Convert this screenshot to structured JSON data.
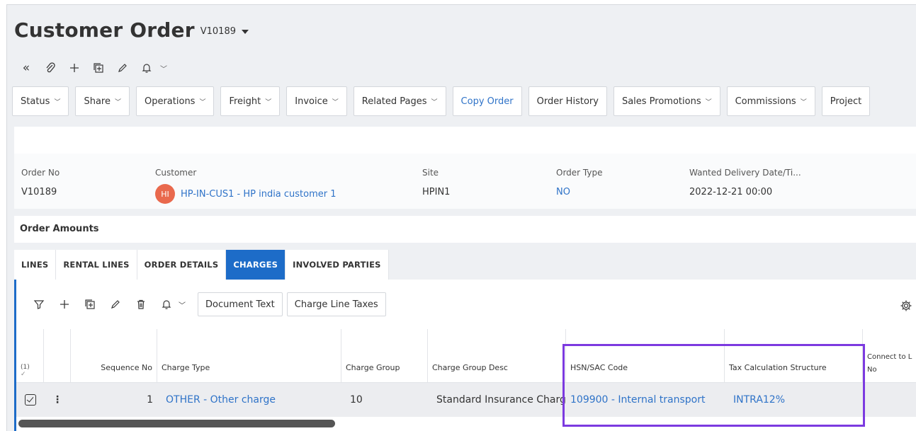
{
  "page": {
    "title": "Customer Order",
    "order_ref": "V10189"
  },
  "commands": [
    {
      "label": "Status",
      "chevron": true,
      "link": false
    },
    {
      "label": "Share",
      "chevron": true,
      "link": false
    },
    {
      "label": "Operations",
      "chevron": true,
      "link": false
    },
    {
      "label": "Freight",
      "chevron": true,
      "link": false
    },
    {
      "label": "Invoice",
      "chevron": true,
      "link": false
    },
    {
      "label": "Related Pages",
      "chevron": true,
      "link": false
    },
    {
      "label": "Copy Order",
      "chevron": false,
      "link": true
    },
    {
      "label": "Order History",
      "chevron": false,
      "link": false
    },
    {
      "label": "Sales Promotions",
      "chevron": true,
      "link": false
    },
    {
      "label": "Commissions",
      "chevron": true,
      "link": false
    },
    {
      "label": "Project",
      "chevron": false,
      "link": false
    }
  ],
  "header": {
    "order_no_label": "Order No",
    "order_no": "V10189",
    "customer_label": "Customer",
    "customer_initials": "HI",
    "customer": "HP-IN-CUS1 - HP india customer 1",
    "site_label": "Site",
    "site": "HPIN1",
    "order_type_label": "Order Type",
    "order_type": "NO",
    "wanted_label": "Wanted Delivery Date/Ti...",
    "wanted": "2022-12-21 00:00"
  },
  "amounts": {
    "title": "Order Amounts"
  },
  "tabs": [
    "LINES",
    "RENTAL LINES",
    "ORDER DETAILS",
    "CHARGES",
    "INVOLVED PARTIES"
  ],
  "active_tab": "CHARGES",
  "grid_toolbar": {
    "document_text": "Document Text",
    "charge_line_taxes": "Charge Line Taxes"
  },
  "table": {
    "selection_count": "(1)",
    "columns": {
      "sequence_no": "Sequence No",
      "charge_type": "Charge Type",
      "charge_group": "Charge Group",
      "charge_group_desc": "Charge Group Desc",
      "hsn_sac": "HSN/SAC Code",
      "tax_calc": "Tax Calculation Structure",
      "connect_to_1": "Connect to L",
      "connect_to_2": "No"
    },
    "rows": [
      {
        "sequence_no": "1",
        "charge_type": "OTHER - Other charge",
        "charge_group": "10",
        "charge_group_desc": "Standard Insurance Charg",
        "hsn_sac": "109900 - Internal transport",
        "tax_calc": "INTRA12%"
      }
    ]
  },
  "colors": {
    "accent": "#1d6cc8",
    "link": "#2f73c8",
    "highlight": "#7c3ae0",
    "avatar": "#e9694d"
  }
}
